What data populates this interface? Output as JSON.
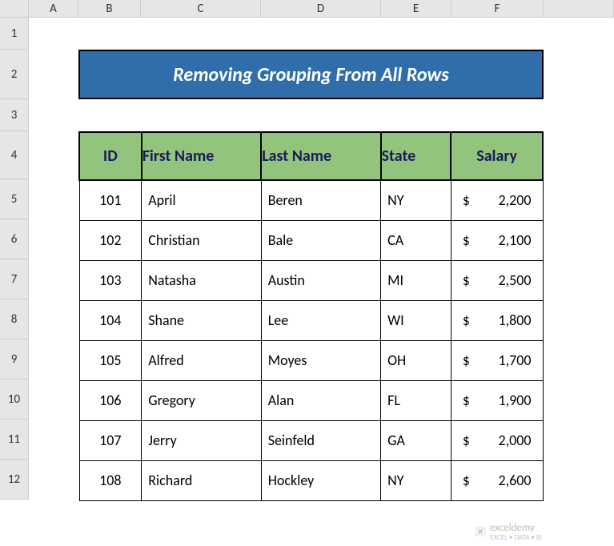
{
  "columns": [
    "A",
    "B",
    "C",
    "D",
    "E",
    "F"
  ],
  "rows": [
    "1",
    "2",
    "3",
    "4",
    "5",
    "6",
    "7",
    "8",
    "9",
    "10",
    "11",
    "12"
  ],
  "title": "Removing Grouping From All Rows",
  "headers": {
    "id": "ID",
    "first": "First Name",
    "last": "Last Name",
    "state": "State",
    "salary": "Salary"
  },
  "data": [
    {
      "id": "101",
      "first": "April",
      "last": "Beren",
      "state": "NY",
      "salary": "2,200"
    },
    {
      "id": "102",
      "first": "Christian",
      "last": "Bale",
      "state": "CA",
      "salary": "2,100"
    },
    {
      "id": "103",
      "first": "Natasha",
      "last": "Austin",
      "state": "MI",
      "salary": "2,500"
    },
    {
      "id": "104",
      "first": "Shane",
      "last": "Lee",
      "state": "WI",
      "salary": "1,800"
    },
    {
      "id": "105",
      "first": "Alfred",
      "last": "Moyes",
      "state": "OH",
      "salary": "1,700"
    },
    {
      "id": "106",
      "first": "Gregory",
      "last": "Alan",
      "state": "FL",
      "salary": "1,900"
    },
    {
      "id": "107",
      "first": "Jerry",
      "last": "Seinfeld",
      "state": "GA",
      "salary": "2,000"
    },
    {
      "id": "108",
      "first": "Richard",
      "last": "Hockley",
      "state": "NY",
      "salary": "2,600"
    }
  ],
  "currency": "$",
  "watermark": {
    "main": "exceldemy",
    "sub": "EXCEL • DATA • BI"
  },
  "chart_data": {
    "type": "table",
    "title": "Removing Grouping From All Rows",
    "columns": [
      "ID",
      "First Name",
      "Last Name",
      "State",
      "Salary"
    ],
    "rows": [
      [
        101,
        "April",
        "Beren",
        "NY",
        2200
      ],
      [
        102,
        "Christian",
        "Bale",
        "CA",
        2100
      ],
      [
        103,
        "Natasha",
        "Austin",
        "MI",
        2500
      ],
      [
        104,
        "Shane",
        "Lee",
        "WI",
        1800
      ],
      [
        105,
        "Alfred",
        "Moyes",
        "OH",
        1700
      ],
      [
        106,
        "Gregory",
        "Alan",
        "FL",
        1900
      ],
      [
        107,
        "Jerry",
        "Seinfeld",
        "GA",
        2000
      ],
      [
        108,
        "Richard",
        "Hockley",
        "NY",
        2600
      ]
    ]
  }
}
